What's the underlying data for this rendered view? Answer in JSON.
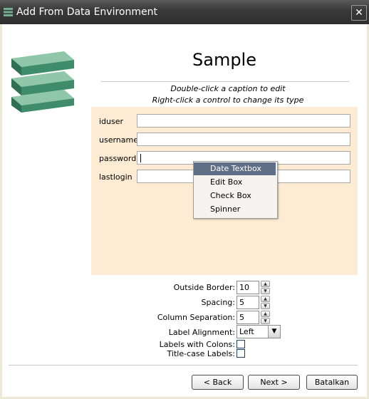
{
  "window": {
    "title": "Add From Data Environment",
    "title_icon": "stack-icon",
    "close_symbol": "✕"
  },
  "page": {
    "heading": "Sample",
    "hint_line1": "Double-click a caption to edit",
    "hint_line2": "Right-click a control to change its type"
  },
  "fields": [
    {
      "label": "iduser"
    },
    {
      "label": "username"
    },
    {
      "label": "password"
    },
    {
      "label": "lastlogin"
    }
  ],
  "context_menu": {
    "items": [
      {
        "label": "Date Textbox",
        "selected": true
      },
      {
        "label": "Edit Box"
      },
      {
        "label": "Check Box"
      },
      {
        "label": "Spinner"
      }
    ]
  },
  "options": {
    "outside_border": {
      "label": "Outside Border:",
      "value": "10"
    },
    "spacing": {
      "label": "Spacing:",
      "value": "5"
    },
    "column_separation": {
      "label": "Column Separation:",
      "value": "5"
    },
    "label_alignment": {
      "label": "Label Alignment:",
      "value": "Left"
    },
    "labels_with_colons": {
      "label": "Labels with Colons:",
      "checked": false
    },
    "title_case_labels": {
      "label": "Title-case Labels:",
      "checked": false
    }
  },
  "buttons": {
    "back": "< Back",
    "next": "Next >",
    "cancel": "Batalkan"
  },
  "colors": {
    "titlebar": "#3a3a3a",
    "canvas_bg": "#fdebd3",
    "menu_highlight": "#5f6f86",
    "logo_green": "#3f8c6a"
  }
}
